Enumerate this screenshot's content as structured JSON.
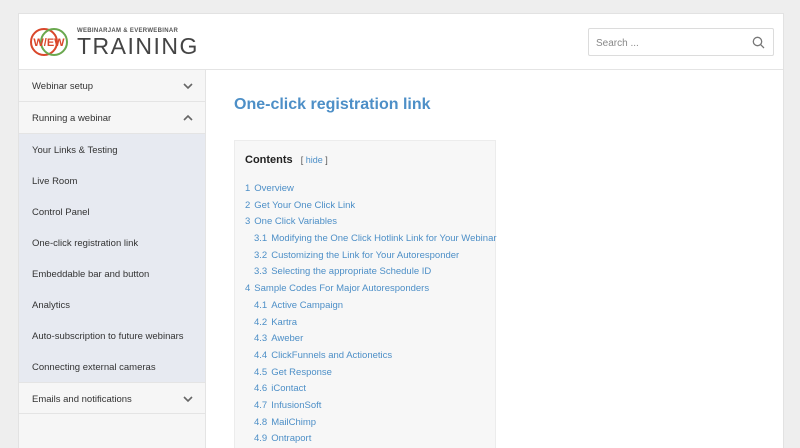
{
  "header": {
    "logo_badge": "W/EW",
    "logo_small": "WEBINARJAM & EVERWEBINAR",
    "logo_big": "TRAINING",
    "search_placeholder": "Search ..."
  },
  "sidebar": {
    "sections": [
      {
        "label": "Webinar setup",
        "expanded": false
      },
      {
        "label": "Running a webinar",
        "expanded": true
      },
      {
        "label": "Emails and notifications",
        "expanded": false
      }
    ],
    "sub_items": [
      "Your Links & Testing",
      "Live Room",
      "Control Panel",
      "One-click registration link",
      "Embeddable bar and button",
      "Analytics",
      "Auto-subscription to future webinars",
      "Connecting external cameras"
    ]
  },
  "main": {
    "title": "One-click registration link",
    "toc": {
      "heading": "Contents",
      "hide_label": "hide",
      "items": [
        {
          "num": "1",
          "text": "Overview",
          "level": 1
        },
        {
          "num": "2",
          "text": "Get Your One Click Link",
          "level": 1
        },
        {
          "num": "3",
          "text": "One Click Variables",
          "level": 1
        },
        {
          "num": "3.1",
          "text": "Modifying the One Click Hotlink Link for Your Webinar",
          "level": 2
        },
        {
          "num": "3.2",
          "text": "Customizing the Link for Your Autoresponder",
          "level": 2
        },
        {
          "num": "3.3",
          "text": "Selecting the appropriate Schedule ID",
          "level": 2
        },
        {
          "num": "4",
          "text": "Sample Codes For Major Autoresponders",
          "level": 1
        },
        {
          "num": "4.1",
          "text": "Active Campaign",
          "level": 2
        },
        {
          "num": "4.2",
          "text": "Kartra",
          "level": 2
        },
        {
          "num": "4.3",
          "text": "Aweber",
          "level": 2
        },
        {
          "num": "4.4",
          "text": "ClickFunnels and Actionetics",
          "level": 2
        },
        {
          "num": "4.5",
          "text": "Get Response",
          "level": 2
        },
        {
          "num": "4.6",
          "text": "iContact",
          "level": 2
        },
        {
          "num": "4.7",
          "text": "InfusionSoft",
          "level": 2
        },
        {
          "num": "4.8",
          "text": "MailChimp",
          "level": 2
        },
        {
          "num": "4.9",
          "text": "Ontraport",
          "level": 2
        }
      ]
    }
  },
  "colors": {
    "accent": "#4d8fc7",
    "logo_red": "#d9472b",
    "logo_green": "#6aa84f",
    "sidebar_active_bg": "#e7eaf1"
  }
}
